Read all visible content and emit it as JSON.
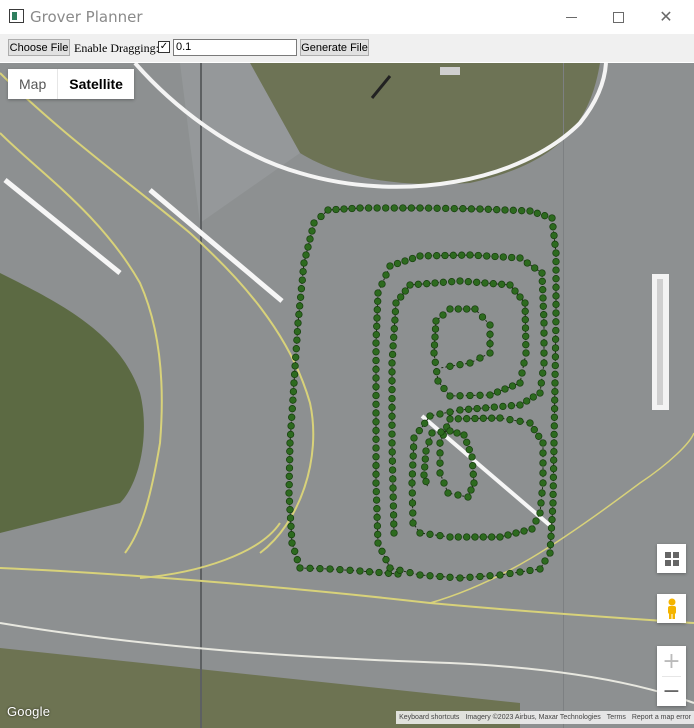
{
  "window": {
    "title": "Grover Planner"
  },
  "toolbar": {
    "choose_file": "Choose File",
    "enable_dragging_label": "Enable Dragging:",
    "dragging_checked": true,
    "input_value": "0.1",
    "generate_file": "Generate File"
  },
  "map": {
    "type_map": "Map",
    "type_satellite": "Satellite",
    "selected_type": "Satellite",
    "google_logo": "Google",
    "attribution": {
      "keyboard": "Keyboard shortcuts",
      "imagery": "Imagery ©2023 Airbus, Maxar Technologies",
      "terms": "Terms",
      "report": "Report a map error"
    },
    "zoom_in": "+",
    "zoom_out": "−"
  },
  "colors": {
    "path_marker": "#2d6a1f",
    "marker_stroke": "#153d0c"
  }
}
